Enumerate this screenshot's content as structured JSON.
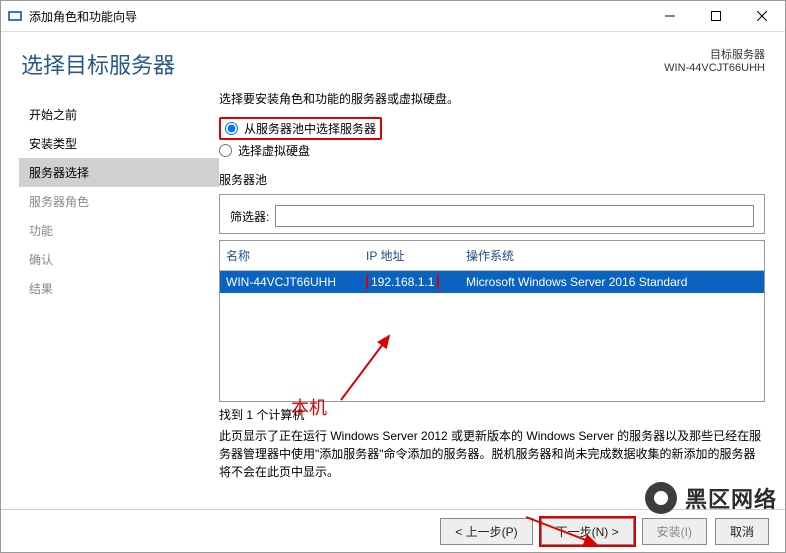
{
  "window": {
    "title": "添加角色和功能向导"
  },
  "header": {
    "page_title": "选择目标服务器",
    "target_label": "目标服务器",
    "target_value": "WIN-44VCJT66UHH"
  },
  "sidebar": {
    "items": [
      {
        "label": "开始之前",
        "state": "available"
      },
      {
        "label": "安装类型",
        "state": "available"
      },
      {
        "label": "服务器选择",
        "state": "selected"
      },
      {
        "label": "服务器角色",
        "state": "disabled"
      },
      {
        "label": "功能",
        "state": "disabled"
      },
      {
        "label": "确认",
        "state": "disabled"
      },
      {
        "label": "结果",
        "state": "disabled"
      }
    ]
  },
  "content": {
    "intro": "选择要安装角色和功能的服务器或虚拟硬盘。",
    "radio1": "从服务器池中选择服务器",
    "radio2": "选择虚拟硬盘",
    "pool_label": "服务器池",
    "filter_label": "筛选器:",
    "filter_value": "",
    "columns": {
      "name": "名称",
      "ip": "IP 地址",
      "os": "操作系统"
    },
    "rows": [
      {
        "name": "WIN-44VCJT66UHH",
        "ip": "192.168.1.1",
        "os": "Microsoft Windows Server 2016 Standard"
      }
    ],
    "found": "找到 1 个计算机",
    "hint": "此页显示了正在运行 Windows Server 2012 或更新版本的 Windows Server 的服务器以及那些已经在服务器管理器中使用\"添加服务器\"命令添加的服务器。脱机服务器和尚未完成数据收集的新添加的服务器将不会在此页中显示。"
  },
  "footer": {
    "prev": "< 上一步(P)",
    "next": "下一步(N) >",
    "install": "安装(I)",
    "cancel": "取消"
  },
  "annotations": {
    "local_machine": "本机",
    "watermark": "黑区网络"
  }
}
